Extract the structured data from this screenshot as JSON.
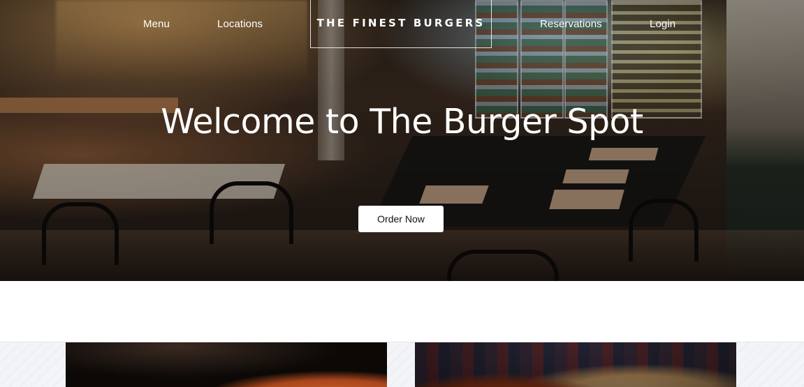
{
  "nav": {
    "items": [
      {
        "label": "Menu"
      },
      {
        "label": "Locations"
      },
      {
        "label": "Reservations"
      },
      {
        "label": "Login"
      }
    ],
    "brand": "THE FINEST BURGERS"
  },
  "hero": {
    "title": "Welcome to The Burger Spot",
    "cta_label": "Order Now"
  },
  "gallery": {
    "cards": [
      {
        "image": "burger-photo-dark"
      },
      {
        "image": "burger-photo-tablecloth"
      }
    ]
  },
  "colors": {
    "nav_text": "#ffffff",
    "button_bg": "#ffffff",
    "button_text": "#111111",
    "section_bg": "#ffffff",
    "pattern_bg": "#f3f4f7"
  }
}
